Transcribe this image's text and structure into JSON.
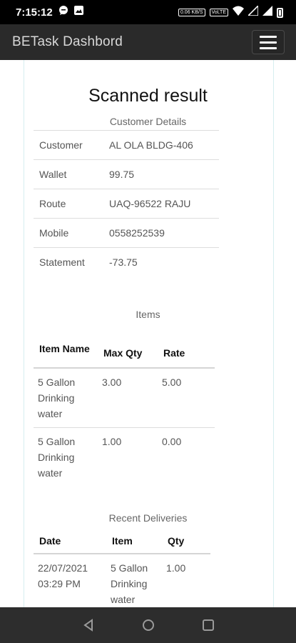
{
  "status": {
    "time": "7:15:12",
    "net_speed": "0.06 KB/S",
    "volte": "VoLTE"
  },
  "appbar": {
    "title": "BETask Dashbord"
  },
  "page": {
    "title": "Scanned result"
  },
  "customer_details": {
    "caption": "Customer Details",
    "rows": [
      {
        "label": "Customer",
        "value": "AL OLA BLDG-406"
      },
      {
        "label": "Wallet",
        "value": "99.75"
      },
      {
        "label": "Route",
        "value": "UAQ-96522 RAJU"
      },
      {
        "label": "Mobile",
        "value": "0558252539"
      },
      {
        "label": "Statement",
        "value": "-73.75"
      }
    ]
  },
  "items": {
    "caption": "Items",
    "headers": [
      "Item Name",
      "Max Qty",
      "Rate"
    ],
    "rows": [
      {
        "name": "5 Gallon Drinking water",
        "max_qty": "3.00",
        "rate": "5.00"
      },
      {
        "name": "5 Gallon Drinking water",
        "max_qty": "1.00",
        "rate": "0.00"
      }
    ]
  },
  "recent_deliveries": {
    "caption": "Recent Deliveries",
    "headers": [
      "Date",
      "Item",
      "Qty"
    ],
    "rows": [
      {
        "date": "22/07/2021 03:29 PM",
        "item": "5 Gallon Drinking water",
        "qty": "1.00"
      }
    ]
  },
  "colors": {
    "status_bar": "#000000",
    "app_bar": "#2a2a2a",
    "nav_bar": "#2d2d2d",
    "card_border": "#d6eef0"
  }
}
